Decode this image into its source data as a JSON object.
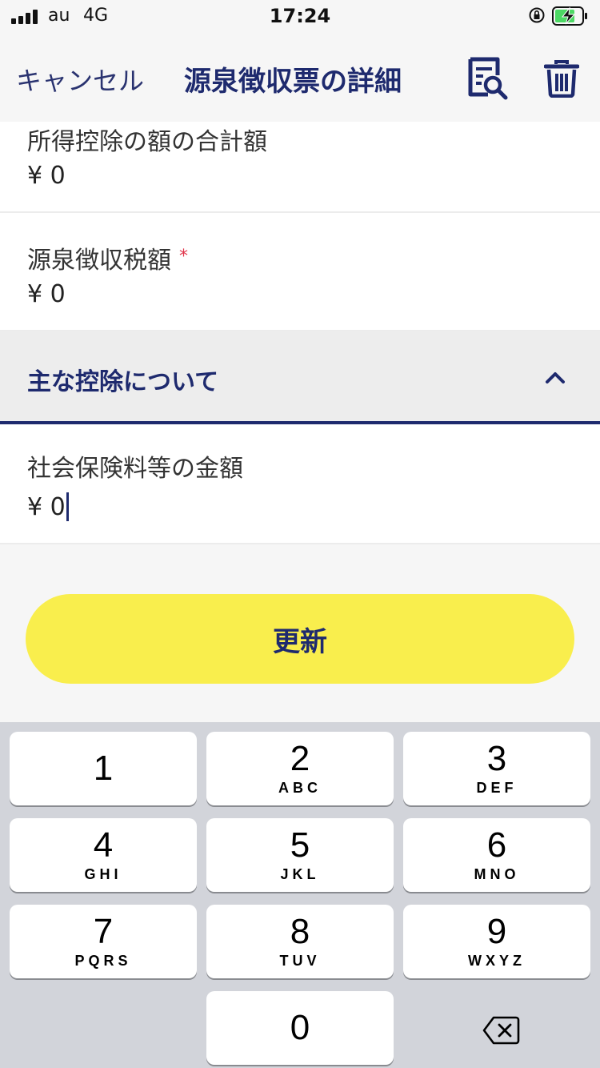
{
  "status_bar": {
    "carrier": "au",
    "network": "4G",
    "time": "17:24"
  },
  "nav": {
    "cancel_label": "キャンセル",
    "title": "源泉徴収票の詳細"
  },
  "fields": [
    {
      "label": "所得控除の額の合計額",
      "value": "¥ 0",
      "required": false
    },
    {
      "label": "源泉徴収税額",
      "value": "¥ 0",
      "required": true,
      "required_mark": "*"
    },
    {
      "label": "社会保険料等の金額",
      "value": "¥ 0",
      "required": false
    }
  ],
  "section": {
    "title": "主な控除について"
  },
  "update_button_label": "更新",
  "keypad": {
    "keys": [
      {
        "num": "1",
        "letters": ""
      },
      {
        "num": "2",
        "letters": "ABC"
      },
      {
        "num": "3",
        "letters": "DEF"
      },
      {
        "num": "4",
        "letters": "GHI"
      },
      {
        "num": "5",
        "letters": "JKL"
      },
      {
        "num": "6",
        "letters": "MNO"
      },
      {
        "num": "7",
        "letters": "PQRS"
      },
      {
        "num": "8",
        "letters": "TUV"
      },
      {
        "num": "9",
        "letters": "WXYZ"
      },
      {
        "num": "0",
        "letters": ""
      }
    ]
  },
  "colors": {
    "brand_navy": "#1e2a6e",
    "button_yellow": "#f9ee4d",
    "required_red": "#e0344a"
  }
}
